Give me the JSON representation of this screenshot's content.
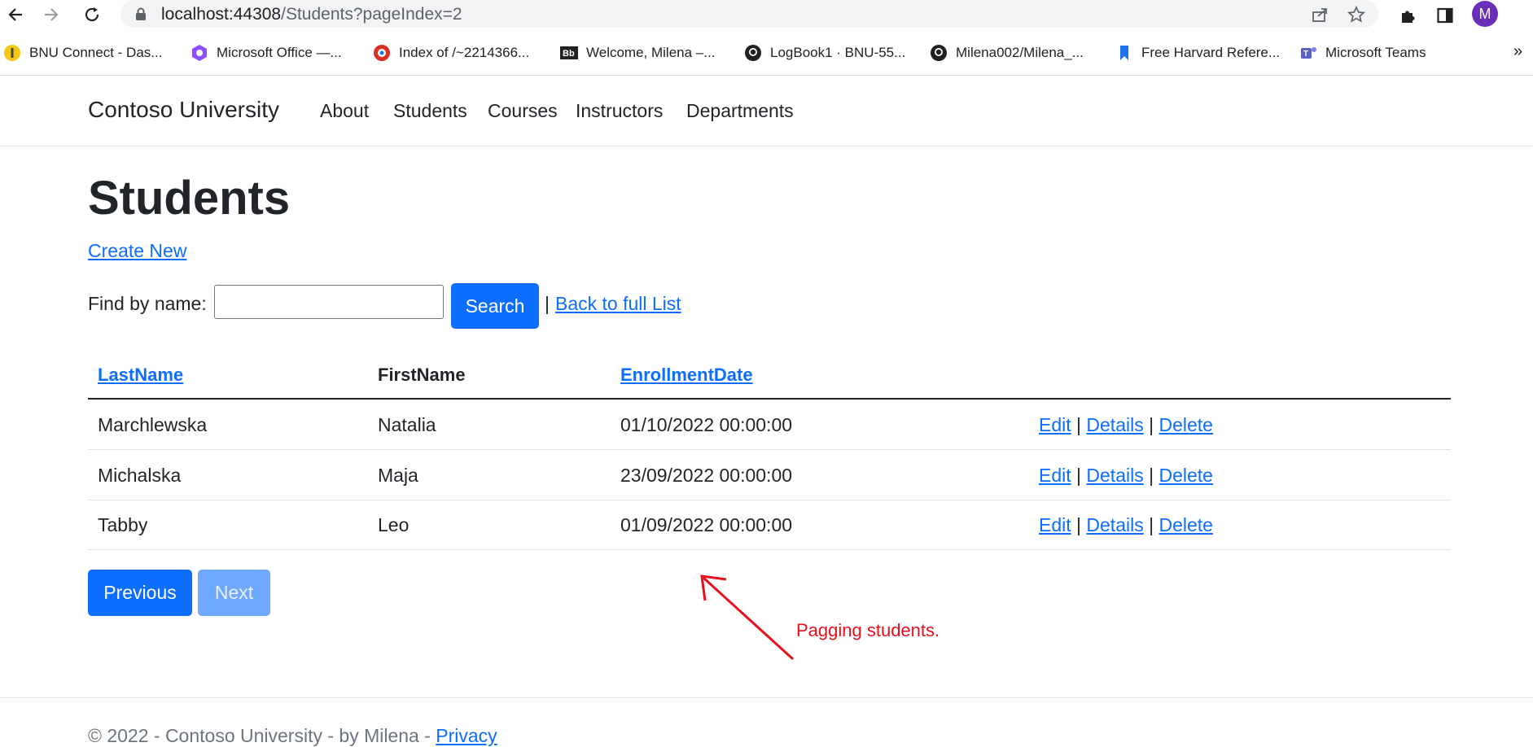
{
  "browser": {
    "url_host": "localhost:44308",
    "url_path": "/Students?pageIndex=2",
    "avatar_letter": "M",
    "bookmarks": [
      {
        "label": "BNU Connect - Das...",
        "icon": "bnu-icon"
      },
      {
        "label": "Microsoft Office —...",
        "icon": "office-icon"
      },
      {
        "label": "Index of /~2214366...",
        "icon": "index-icon"
      },
      {
        "label": "Welcome, Milena –...",
        "icon": "blackboard-icon"
      },
      {
        "label": "LogBook1 · BNU-55...",
        "icon": "github-icon"
      },
      {
        "label": "Milena002/Milena_...",
        "icon": "github-icon"
      },
      {
        "label": "Free Harvard Refere...",
        "icon": "bookmark-icon"
      },
      {
        "label": "Microsoft Teams",
        "icon": "teams-icon"
      }
    ],
    "bookmarks_more": "»"
  },
  "site": {
    "brand": "Contoso University",
    "nav": [
      "About",
      "Students",
      "Courses",
      "Instructors",
      "Departments"
    ]
  },
  "page": {
    "title": "Students",
    "create_new": "Create New",
    "find_label": "Find by name:",
    "search_value": "",
    "search_button": "Search",
    "separator": "|",
    "back_link": "Back to full List"
  },
  "table": {
    "headers": [
      "LastName",
      "FirstName",
      "EnrollmentDate"
    ],
    "rows": [
      {
        "last": "Marchlewska",
        "first": "Natalia",
        "date": "01/10/2022 00:00:00"
      },
      {
        "last": "Michalska",
        "first": "Maja",
        "date": "23/09/2022 00:00:00"
      },
      {
        "last": "Tabby",
        "first": "Leo",
        "date": "01/09/2022 00:00:00"
      }
    ],
    "actions": {
      "edit": "Edit",
      "details": "Details",
      "delete": "Delete",
      "sep": "|"
    }
  },
  "pager": {
    "previous": "Previous",
    "next": "Next"
  },
  "annotation": {
    "text": "Pagging students.",
    "color": "#e8101c"
  },
  "footer": {
    "text": "© 2022 - Contoso University - by Milena -",
    "privacy": "Privacy"
  },
  "colors": {
    "primary": "#0d6efd",
    "disabled": "#6ea8fe"
  }
}
